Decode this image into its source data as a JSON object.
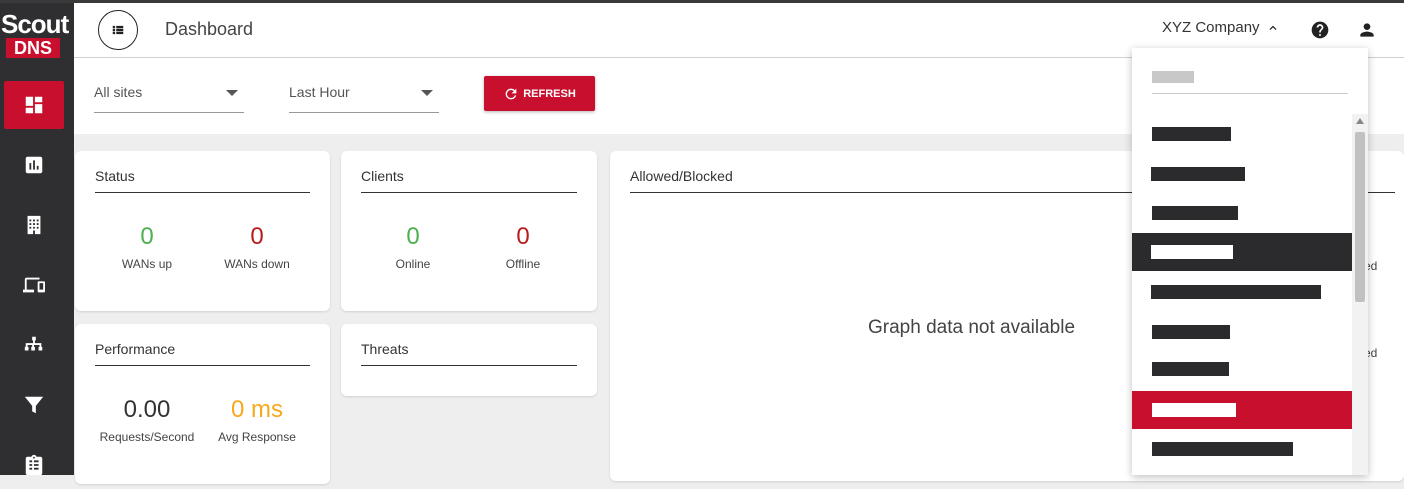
{
  "app": {
    "logo_top": "Scout",
    "logo_bottom": "DNS",
    "accent": "#c8102e",
    "sidebar_bg": "#2f2f31"
  },
  "header": {
    "title": "Dashboard",
    "company": "XYZ Company",
    "icons": [
      "menu-list-icon",
      "chevron-up-icon",
      "help-icon",
      "user-icon"
    ]
  },
  "sidebar": {
    "items": [
      {
        "icon": "dashboard-icon",
        "active": true
      },
      {
        "icon": "bar-chart-icon",
        "active": false
      },
      {
        "icon": "building-icon",
        "active": false
      },
      {
        "icon": "devices-icon",
        "active": false
      },
      {
        "icon": "sitemap-icon",
        "active": false
      },
      {
        "icon": "filter-icon",
        "active": false
      },
      {
        "icon": "clipboard-icon",
        "active": false
      }
    ]
  },
  "filters": {
    "site": "All sites",
    "period": "Last Hour",
    "refresh_label": "REFRESH"
  },
  "status": {
    "title": "Status",
    "wans_up": "0",
    "wans_up_label": "WANs up",
    "wans_down": "0",
    "wans_down_label": "WANs down"
  },
  "clients": {
    "title": "Clients",
    "online": "0",
    "online_label": "Online",
    "offline": "0",
    "offline_label": "Offline"
  },
  "performance": {
    "title": "Performance",
    "rps": "0.00",
    "rps_label": "Requests/Second",
    "avg": "0 ms",
    "avg_label": "Avg Response"
  },
  "threats": {
    "title": "Threats"
  },
  "allowed_blocked": {
    "title": "Allowed/Blocked",
    "empty": "Graph data not available",
    "legend_fragment_1": "ed",
    "legend_fragment_2": "ed"
  }
}
